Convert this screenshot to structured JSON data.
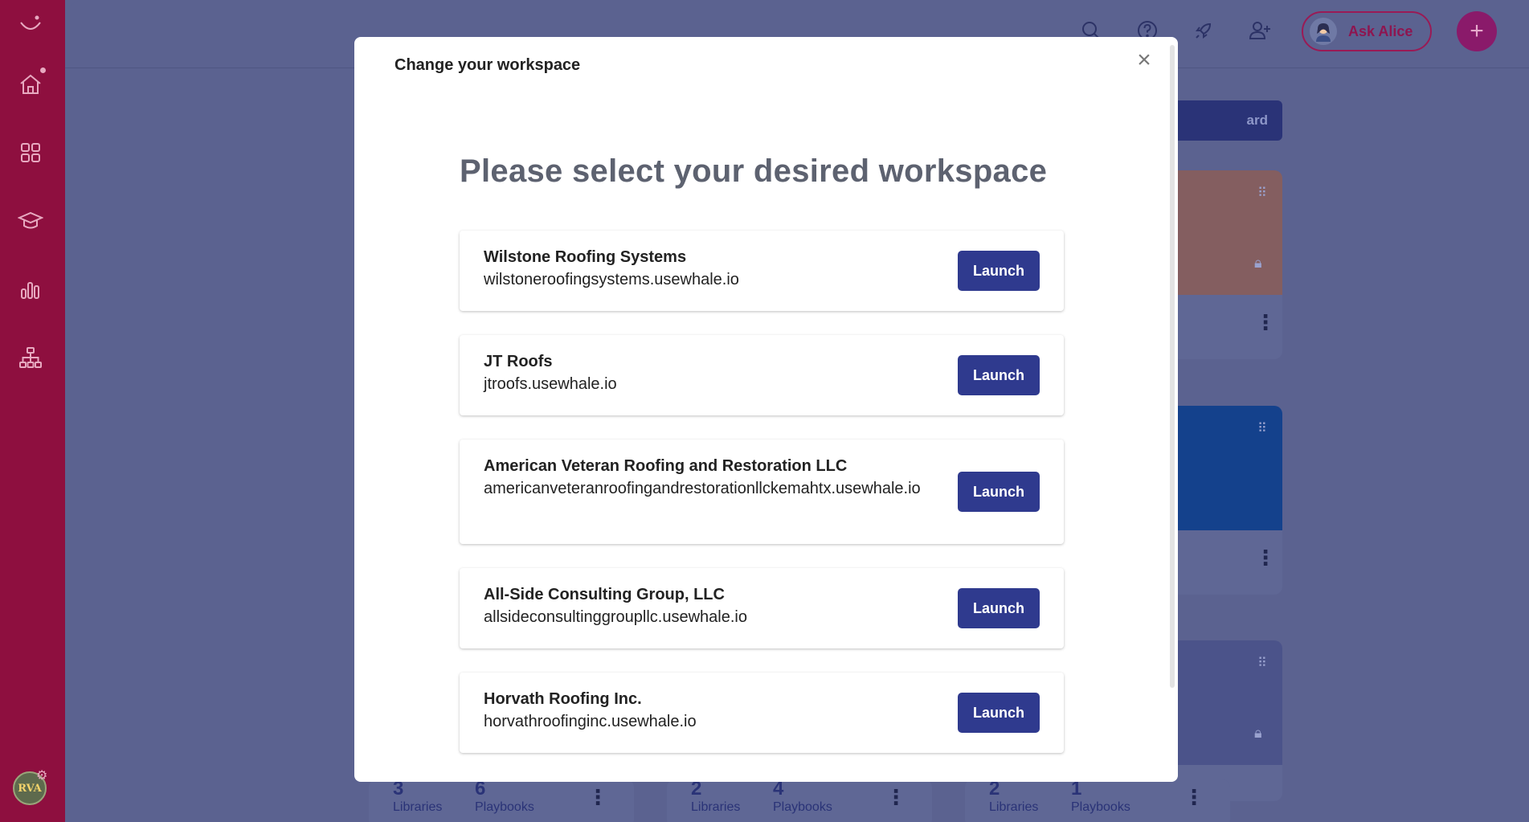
{
  "header": {
    "ask_label": "Ask Alice"
  },
  "sidebar": {
    "items": [
      {
        "icon": "home-icon"
      },
      {
        "icon": "grid-icon"
      },
      {
        "icon": "graduation-cap-icon"
      },
      {
        "icon": "bar-chart-icon"
      },
      {
        "icon": "org-chart-icon"
      }
    ],
    "avatar_text": "RVA"
  },
  "background": {
    "button_label": "ard",
    "stats": [
      {
        "libraries": "3",
        "libraries_label": "Libraries",
        "playbooks": "6",
        "playbooks_label": "Playbooks"
      },
      {
        "libraries": "2",
        "libraries_label": "Libraries",
        "playbooks": "4",
        "playbooks_label": "Playbooks"
      },
      {
        "libraries": "2",
        "libraries_label": "Libraries",
        "playbooks": "1",
        "playbooks_label": "Playbooks"
      }
    ]
  },
  "modal": {
    "title": "Change your workspace",
    "close_label": "×",
    "heading": "Please select your desired workspace",
    "launch_label": "Launch",
    "workspaces": [
      {
        "name": "Wilstone Roofing Systems",
        "domain": "wilstoneroofingsystems.usewhale.io"
      },
      {
        "name": "JT Roofs",
        "domain": "jtroofs.usewhale.io"
      },
      {
        "name": "American Veteran Roofing and Restoration LLC",
        "domain": "americanveteranroofingandrestorationllckemahtx.usewhale.io"
      },
      {
        "name": "All-Side Consulting Group, LLC",
        "domain": "allsideconsultinggroupllc.usewhale.io"
      },
      {
        "name": "Horvath Roofing Inc.",
        "domain": "horvathroofinginc.usewhale.io"
      }
    ]
  },
  "colors": {
    "sidebar": "#8e0f3f",
    "overlay": "#5b6290",
    "launch": "#2f3a8e",
    "accent": "#9a1a55"
  }
}
